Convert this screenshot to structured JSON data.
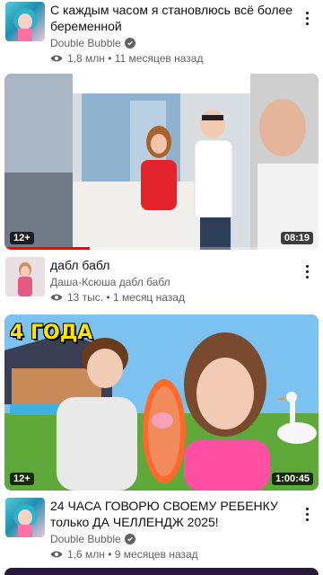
{
  "items": [
    {
      "title": "С каждым часом я становлюсь всё более беременной",
      "channel": "Double Bubble",
      "verified": true,
      "stats": "1,8 млн • 11 месяцев назад"
    },
    {
      "age_badge": "12+",
      "duration": "08:19",
      "watched_fraction": 0.27,
      "title": "дабл бабл",
      "channel": "Даша-Ксюша дабл бабл",
      "stats": "13 тыс. • 1 месяц назад"
    },
    {
      "thumbnail_text": "4 ГОДА",
      "age_badge": "12+",
      "duration": "1:00:45",
      "title": "24 ЧАСА ГОВОРЮ СВОЕМУ РЕБЕНКУ только ДА ЧЕЛЛЕНДЖ 2025!",
      "channel": "Double Bubble",
      "verified": true,
      "stats": "1,6 млн • 9 месяцев назад"
    }
  ],
  "colors": {
    "accent": "#ff0000",
    "secondary_text": "#606060"
  },
  "icons": [
    "more-vert-icon",
    "verified-check-icon",
    "views-eye-icon"
  ]
}
